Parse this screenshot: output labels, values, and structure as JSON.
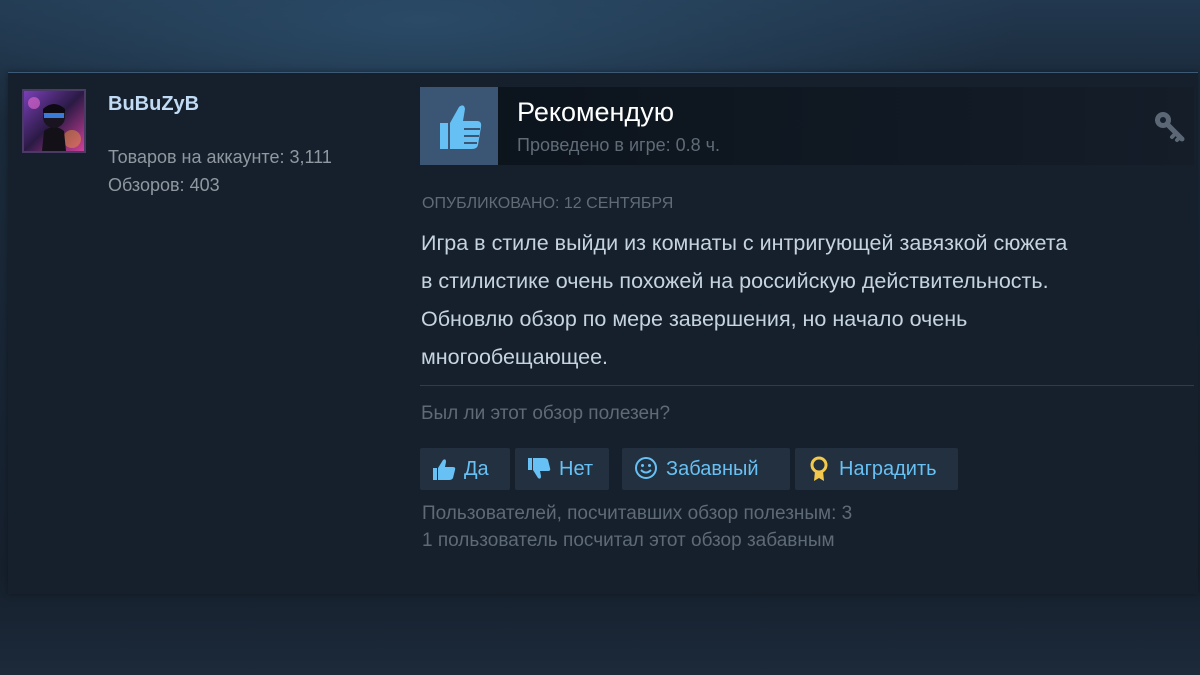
{
  "author": {
    "name": "BuBuZyB",
    "products_label": "Товаров на аккаунте: 3,111",
    "reviews_label": "Обзоров: 403"
  },
  "review": {
    "recommendation": "Рекомендую",
    "playtime": "Проведено в игре: 0.8 ч.",
    "posted": "ОПУБЛИКОВАНО: 12 СЕНТЯБРЯ",
    "text_lines": [
      "Игра в стиле выйди из комнаты с интригующей завязкой сюжета",
      "в стилистике очень похожей на российскую действительность.",
      "Обновлю обзор по мере завершения, но начало очень",
      "многообещающее."
    ],
    "helpful_question": "Был ли этот обзор полезен?"
  },
  "buttons": {
    "yes": "Да",
    "no": "Нет",
    "funny": "Забавный",
    "award": "Наградить"
  },
  "footer": {
    "helpful_count": "Пользователей, посчитавших обзор полезным: 3",
    "funny_count": "1 пользователь посчитал этот обзор забавным"
  },
  "icons": {
    "recommend": "thumbs-up-icon",
    "key": "key-icon",
    "yes": "thumbs-up-icon",
    "no": "thumbs-down-icon",
    "funny": "smiley-icon",
    "award": "award-ribbon-icon"
  },
  "colors": {
    "accent": "#67c1f5",
    "author_name": "#c1dbf4",
    "thumb_bg": "#3a5674",
    "award": "#f2c94c"
  }
}
